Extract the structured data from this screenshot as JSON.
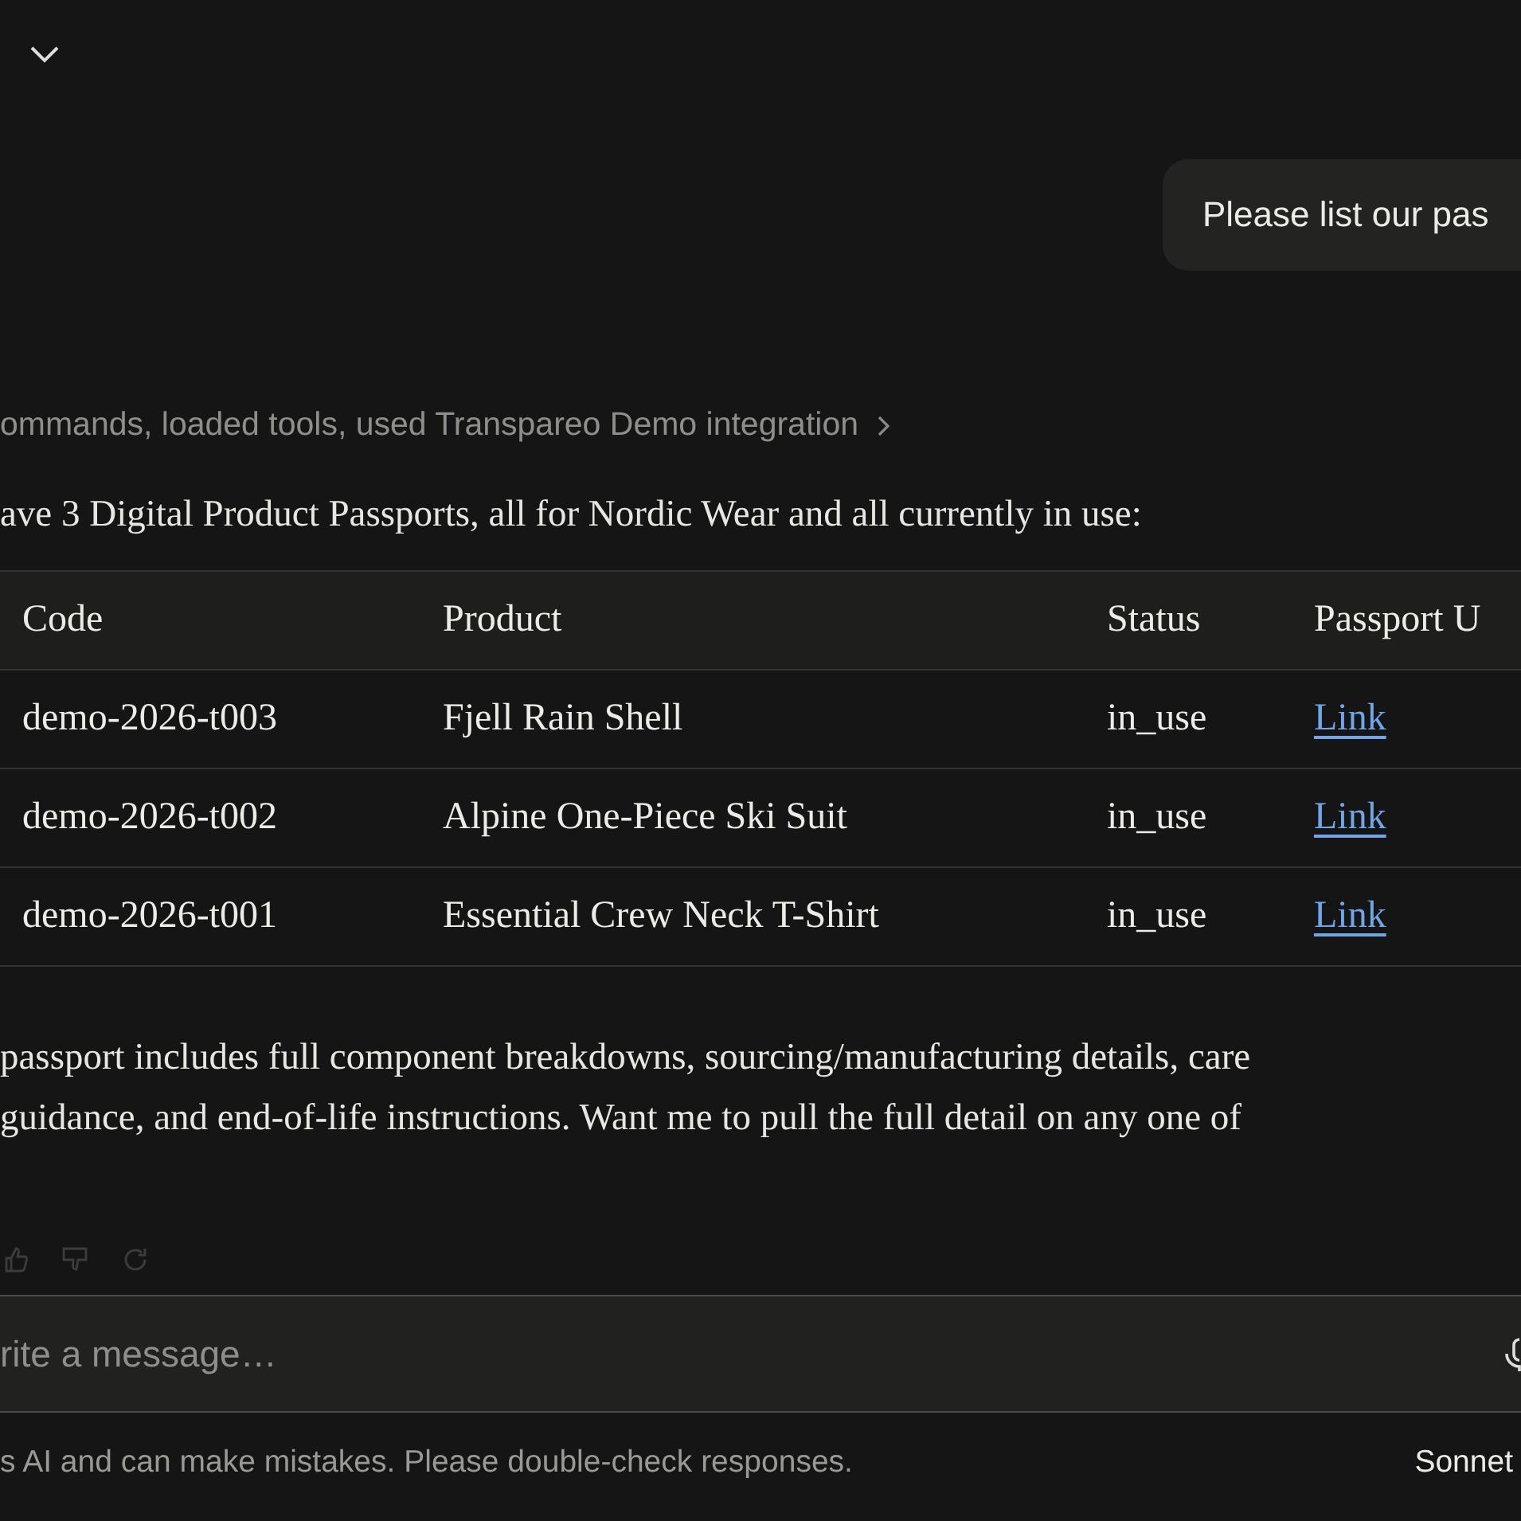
{
  "user_message": "Please list our pas",
  "tool_summary": "ommands, loaded tools, used Transpareo Demo integration",
  "intro": "ave 3 Digital Product Passports, all for Nordic Wear and all currently in use:",
  "table": {
    "columns": [
      "Code",
      "Product",
      "Status",
      "Passport U"
    ],
    "rows": [
      {
        "code": "demo-2026-t003",
        "product": "Fjell Rain Shell",
        "status": "in_use",
        "link": "Link"
      },
      {
        "code": "demo-2026-t002",
        "product": "Alpine One-Piece Ski Suit",
        "status": "in_use",
        "link": "Link"
      },
      {
        "code": "demo-2026-t001",
        "product": "Essential Crew Neck T-Shirt",
        "status": "in_use",
        "link": "Link"
      }
    ]
  },
  "closing": [
    "passport includes full component breakdowns, sourcing/manufacturing details, care",
    "guidance, and end-of-life instructions. Want me to pull the full detail on any one of"
  ],
  "composer": {
    "placeholder": "rite a message…"
  },
  "disclaimer": "s AI and can make mistakes. Please double-check responses.",
  "model": "Sonnet"
}
